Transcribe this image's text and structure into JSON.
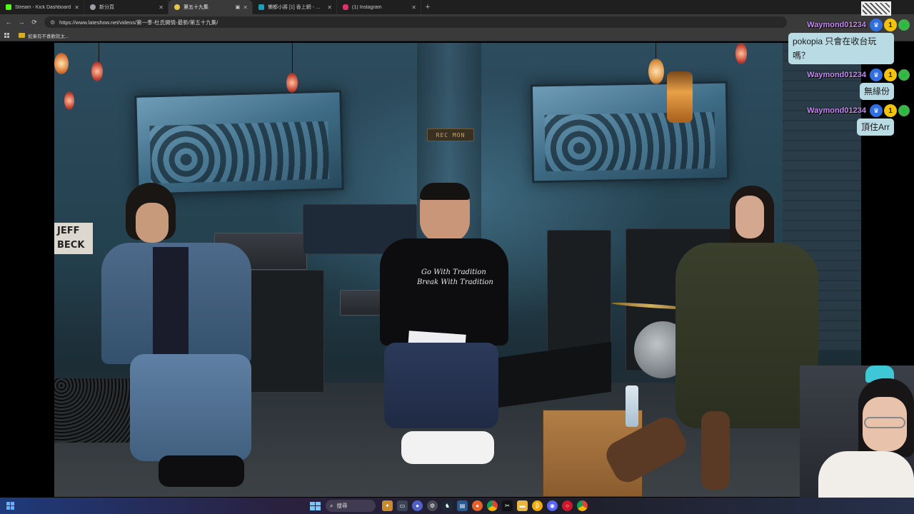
{
  "browser": {
    "tabs": [
      {
        "title": "Stream - Kick Dashboard",
        "favicon_color": "#53fc18",
        "active": false
      },
      {
        "title": "新分頁",
        "favicon_color": "#9aa0a6",
        "active": false
      },
      {
        "title": "第五十九集",
        "favicon_color": "#e6c84a",
        "active": true
      },
      {
        "title": "懶都小將 [1] 香上網 - 巴哈姆特",
        "favicon_color": "#1aa0b5",
        "active": false
      },
      {
        "title": "(1) Instagram",
        "favicon_color": "#e1306c",
        "active": false
      }
    ],
    "new_tab_label": "+",
    "url": "https://www.lateshow.net/videos/第一季-杜氏開情-最新/第五十九集/",
    "bookmarks": [
      {
        "label": "如果有不喜歡就太..."
      }
    ]
  },
  "video": {
    "sign_text": "REC MON",
    "jeff_text_line1": "JEFF",
    "jeff_text_line2": "BECK",
    "tee_line1": "Go With Tradition",
    "tee_line2": "Break With Tradition"
  },
  "chat": {
    "messages": [
      {
        "username": "Waymond01234",
        "text": "pokopia 只會在收台玩嗎？"
      },
      {
        "username": "Waymond01234",
        "text": "無緣份"
      },
      {
        "username": "Waymond01234",
        "text": "頂住Arr"
      }
    ],
    "badge_sub_number": "1"
  },
  "taskbar": {
    "search_label": "搜尋",
    "icons": [
      "explorer-icon",
      "media-icon",
      "zoom-icon",
      "settings-icon",
      "steam-icon",
      "photos-icon",
      "firefox-icon",
      "chrome-icon",
      "capcut-icon",
      "folder-icon",
      "bitcoin-icon",
      "discord-icon",
      "opera-icon",
      "chrome-alt-icon"
    ]
  },
  "colors": {
    "chat_username": "#c58cf0",
    "chat_bubble": "#b9dbe4",
    "tabbar_bg": "#1f1f1f",
    "toolbar_bg": "#3a3a3a"
  }
}
